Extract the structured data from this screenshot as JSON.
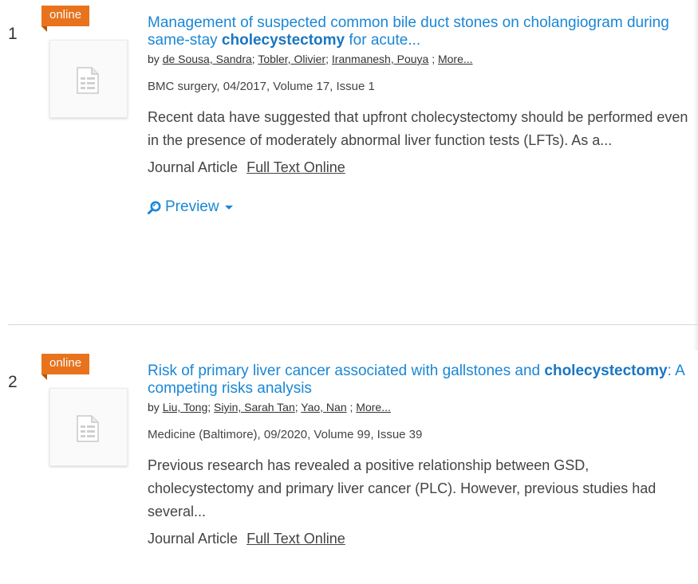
{
  "results": [
    {
      "number": "1",
      "badge": "online",
      "title_prefix": "Management of suspected common bile duct stones on cholangiogram during same-stay ",
      "title_highlight": "cholecystectomy",
      "title_suffix": " for acute...",
      "by_label": "by",
      "authors": [
        "de Sousa, Sandra",
        "Tobler, Olivier",
        "Iranmanesh, Pouya"
      ],
      "more_label": "More...",
      "publication": "BMC surgery, 04/2017, Volume 17, Issue 1",
      "abstract": "Recent data have suggested that upfront cholecystectomy should be performed even in the presence of moderately abnormal liver function tests (LFTs). As a...",
      "type": "Journal Article",
      "fulltext_label": "Full Text Online",
      "preview_label": "Preview"
    },
    {
      "number": "2",
      "badge": "online",
      "title_prefix": "Risk of primary liver cancer associated with gallstones and ",
      "title_highlight": "cholecystectomy",
      "title_suffix": ": A competing risks analysis",
      "by_label": "by",
      "authors": [
        "Liu, Tong",
        "Siyin, Sarah Tan",
        "Yao, Nan"
      ],
      "more_label": "More...",
      "publication": "Medicine (Baltimore), 09/2020, Volume 99, Issue 39",
      "abstract": "Previous research has revealed a positive relationship between GSD, cholecystectomy and primary liver cancer (PLC). However, previous studies had several...",
      "type": "Journal Article",
      "fulltext_label": "Full Text Online"
    }
  ],
  "colors": {
    "link": "#1a87d6",
    "badge": "#e8731c"
  },
  "icons": {
    "document": "document-icon",
    "preview": "magnifier-icon"
  }
}
